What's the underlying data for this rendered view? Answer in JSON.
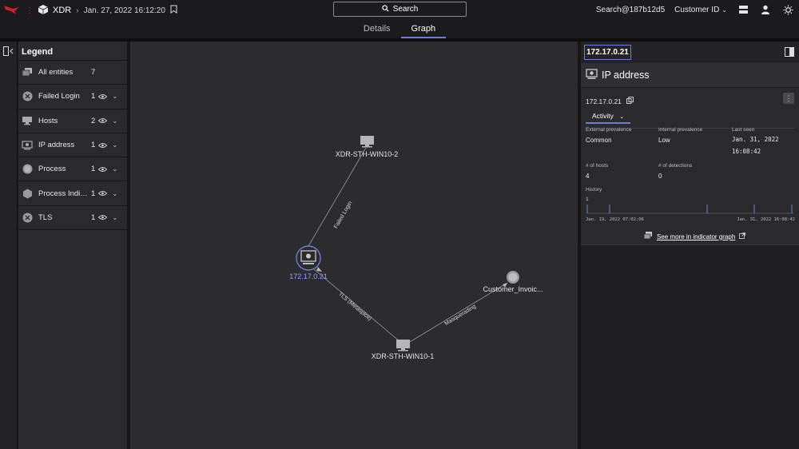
{
  "header": {
    "app_name": "XDR",
    "timestamp": "Jan. 27, 2022 16:12:20",
    "search_label": "Search",
    "search_id": "Search@187b12d5",
    "customer_id_label": "Customer ID"
  },
  "tabs": [
    {
      "label": "Details",
      "active": false
    },
    {
      "label": "Graph",
      "active": true
    }
  ],
  "legend": {
    "title": "Legend",
    "items": [
      {
        "label": "All entities",
        "count": "7",
        "icon": "all-entities-icon"
      },
      {
        "label": "Failed Login",
        "count": "1",
        "icon": "failed-login-icon"
      },
      {
        "label": "Hosts",
        "count": "2",
        "icon": "host-icon"
      },
      {
        "label": "IP address",
        "count": "1",
        "icon": "ip-address-icon"
      },
      {
        "label": "Process",
        "count": "1",
        "icon": "process-icon"
      },
      {
        "label": "Process Indicat...",
        "count": "1",
        "icon": "process-indicator-icon"
      },
      {
        "label": "TLS",
        "count": "1",
        "icon": "tls-icon"
      }
    ]
  },
  "graph": {
    "nodes": {
      "host2": "XDR-STH-WIN10-2",
      "ip": "172.17.0.21",
      "process": "Customer_Invoic...",
      "host1": "XDR-STH-WIN10-1"
    },
    "edges": {
      "failed_login": "Failed Login",
      "tls": "TLS (Metasploit)",
      "masquerading": "Masquerading"
    }
  },
  "detail_panel": {
    "ip_title": "172.17.0.21",
    "type_title": "IP address",
    "ip_value": "172.17.0.21",
    "activity_tab": "Activity",
    "external_prevalence_label": "External prevalence",
    "external_prevalence_value": "Common",
    "internal_prevalence_label": "Internal prevalence",
    "internal_prevalence_value": "Low",
    "last_seen_label": "Last seen",
    "last_seen_date": "Jan. 31, 2022",
    "last_seen_time": "16:08:42",
    "hosts_label": "# of hosts",
    "hosts_value": "4",
    "detections_label": "# of detections",
    "detections_value": "0",
    "history_label": "History",
    "history_axis_max": "1",
    "history_start": "Jan. 19, 2022 07:02:06",
    "history_end": "Jan. 31, 2022 16:08:42",
    "see_more_label": "See more in indicator graph"
  },
  "colors": {
    "accent": "#6a7fd8",
    "selected_node": "#8ea0ff",
    "brand_red": "#d0232b"
  }
}
